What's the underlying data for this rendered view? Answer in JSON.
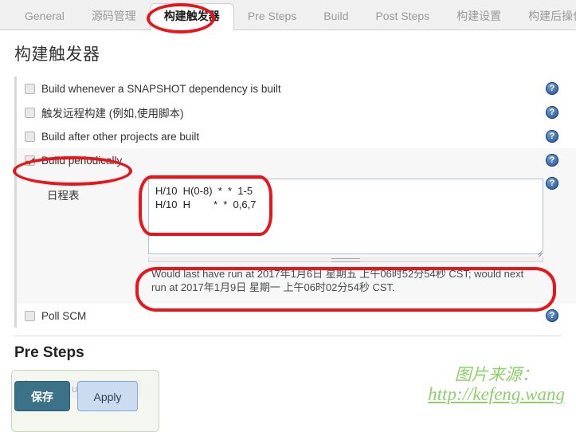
{
  "tabs": [
    {
      "label": "General",
      "active": false
    },
    {
      "label": "源码管理",
      "active": false
    },
    {
      "label": "构建触发器",
      "active": true
    },
    {
      "label": "Pre Steps",
      "active": false
    },
    {
      "label": "Build",
      "active": false
    },
    {
      "label": "Post Steps",
      "active": false
    },
    {
      "label": "构建设置",
      "active": false
    },
    {
      "label": "构建后操作",
      "active": false
    }
  ],
  "page": {
    "title": "构建触发器"
  },
  "triggers": [
    {
      "label": "Build whenever a SNAPSHOT dependency is built",
      "checked": false,
      "help": "?"
    },
    {
      "label": "触发远程构建 (例如,使用脚本)",
      "checked": false,
      "help": "?"
    },
    {
      "label": "Build after other projects are built",
      "checked": false,
      "help": "?"
    },
    {
      "label": "Build periodically",
      "checked": true,
      "help": "?"
    }
  ],
  "schedule": {
    "label": "日程表",
    "value": "H/10  H(0-8)  *  *  1-5\nH/10  H        *  *  0,6,7",
    "placeholder": "",
    "status": "Would last have run at 2017年1月6日 星期五 上午06时52分54秒 CST; would next run at 2017年1月9日 星期一 上午06时02分54秒 CST.",
    "help": "?"
  },
  "poll_scm": {
    "label": "Poll SCM",
    "checked": false,
    "help": "?"
  },
  "pre_steps": {
    "heading": "Pre Steps",
    "hidden_field_text": "uild"
  },
  "save_bar": {
    "save_label": "保存",
    "apply_label": "Apply"
  },
  "watermark": {
    "top": "图片来源：",
    "url": "http://kefeng.wang"
  },
  "colors": {
    "accent_blue": "#27518f",
    "annotation_red": "#e8151b",
    "save_button": "#3b7287",
    "apply_button": "#cbdcf0",
    "watermark_green": "#8ed06a"
  }
}
